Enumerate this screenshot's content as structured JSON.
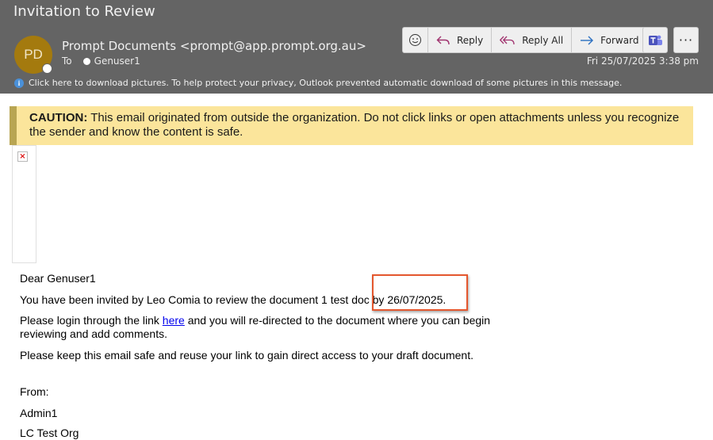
{
  "subject": "Invitation to Review",
  "sender": {
    "initials": "PD",
    "display": "Prompt Documents <prompt@app.prompt.org.au>",
    "to_label": "To",
    "recipient": "Genuser1",
    "date": "Fri 25/07/2025 3:38 pm"
  },
  "toolbar": {
    "reply": "Reply",
    "reply_all": "Reply All",
    "forward": "Forward",
    "more": "···"
  },
  "info_bar": "Click here to download pictures. To help protect your privacy, Outlook prevented automatic download of some pictures in this message.",
  "caution": {
    "label": "CAUTION:",
    "text": " This email originated from outside the organization. Do not click links or open attachments unless you recognize the sender and know the content is safe."
  },
  "body": {
    "greeting": "Dear Genuser1",
    "line1": "You have been invited by Leo Comia to review the document 1 test doc by 26/07/2025.",
    "line2_pre": "Please login through the link ",
    "line2_link": "here",
    "line2_post": " and you will re-directed to the document where you can begin reviewing and add comments.",
    "line3": "Please keep this email safe and reuse your link to gain direct access to your draft document.",
    "from_label": "From:",
    "from_name": "Admin1",
    "org": "LC Test Org"
  },
  "colors": {
    "header_bg": "#646464",
    "avatar_bg": "#a47a0e",
    "caution_bg": "#fbe59b",
    "highlight_border": "#e4572e",
    "link": "#0000ee"
  }
}
